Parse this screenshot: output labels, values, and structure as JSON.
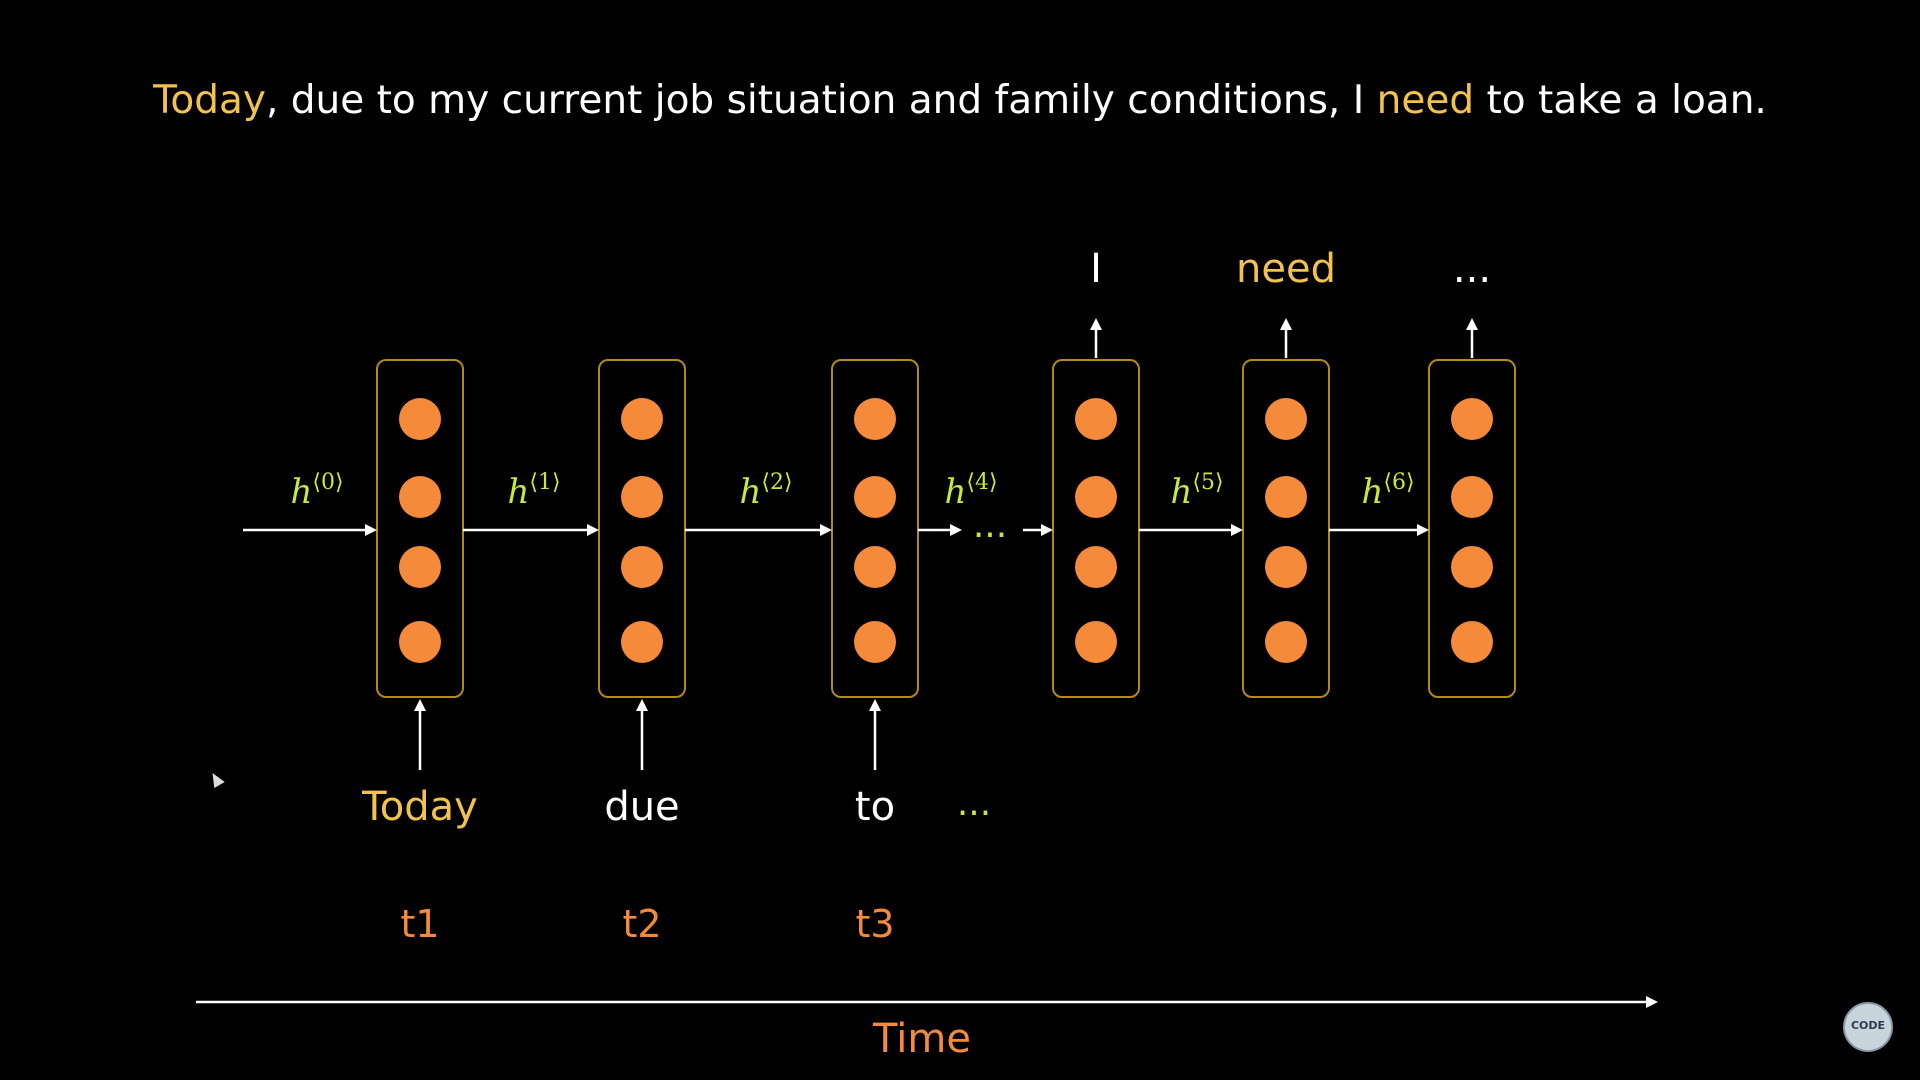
{
  "sentence": {
    "w1": "Today",
    "w2": ", due to my current job situation and family conditions, I ",
    "w3": "need",
    "w4": " to take a loan."
  },
  "colors": {
    "highlight": "#f2c14e",
    "node": "#f48a3a",
    "hidden_label": "#c8e83a",
    "box": "#b08a1a",
    "time_label": "#f48a3a"
  },
  "hidden_states": [
    {
      "base": "h",
      "sup": "⟨0⟩"
    },
    {
      "base": "h",
      "sup": "⟨1⟩"
    },
    {
      "base": "h",
      "sup": "⟨2⟩"
    },
    {
      "base": "h",
      "sup": "⟨4⟩"
    },
    {
      "base": "h",
      "sup": "⟨5⟩"
    },
    {
      "base": "h",
      "sup": "⟨6⟩"
    }
  ],
  "gap_ellipsis": "...",
  "inputs": [
    {
      "text": "Today",
      "highlight": true
    },
    {
      "text": "due",
      "highlight": false
    },
    {
      "text": "to",
      "highlight": false
    }
  ],
  "input_ellipsis": "...",
  "outputs": [
    {
      "text": "I",
      "highlight": false
    },
    {
      "text": "need",
      "highlight": true
    },
    {
      "text": "...",
      "highlight": false
    }
  ],
  "timesteps": [
    "t1",
    "t2",
    "t3"
  ],
  "time_axis_label": "Time",
  "logo_text": "CODE"
}
